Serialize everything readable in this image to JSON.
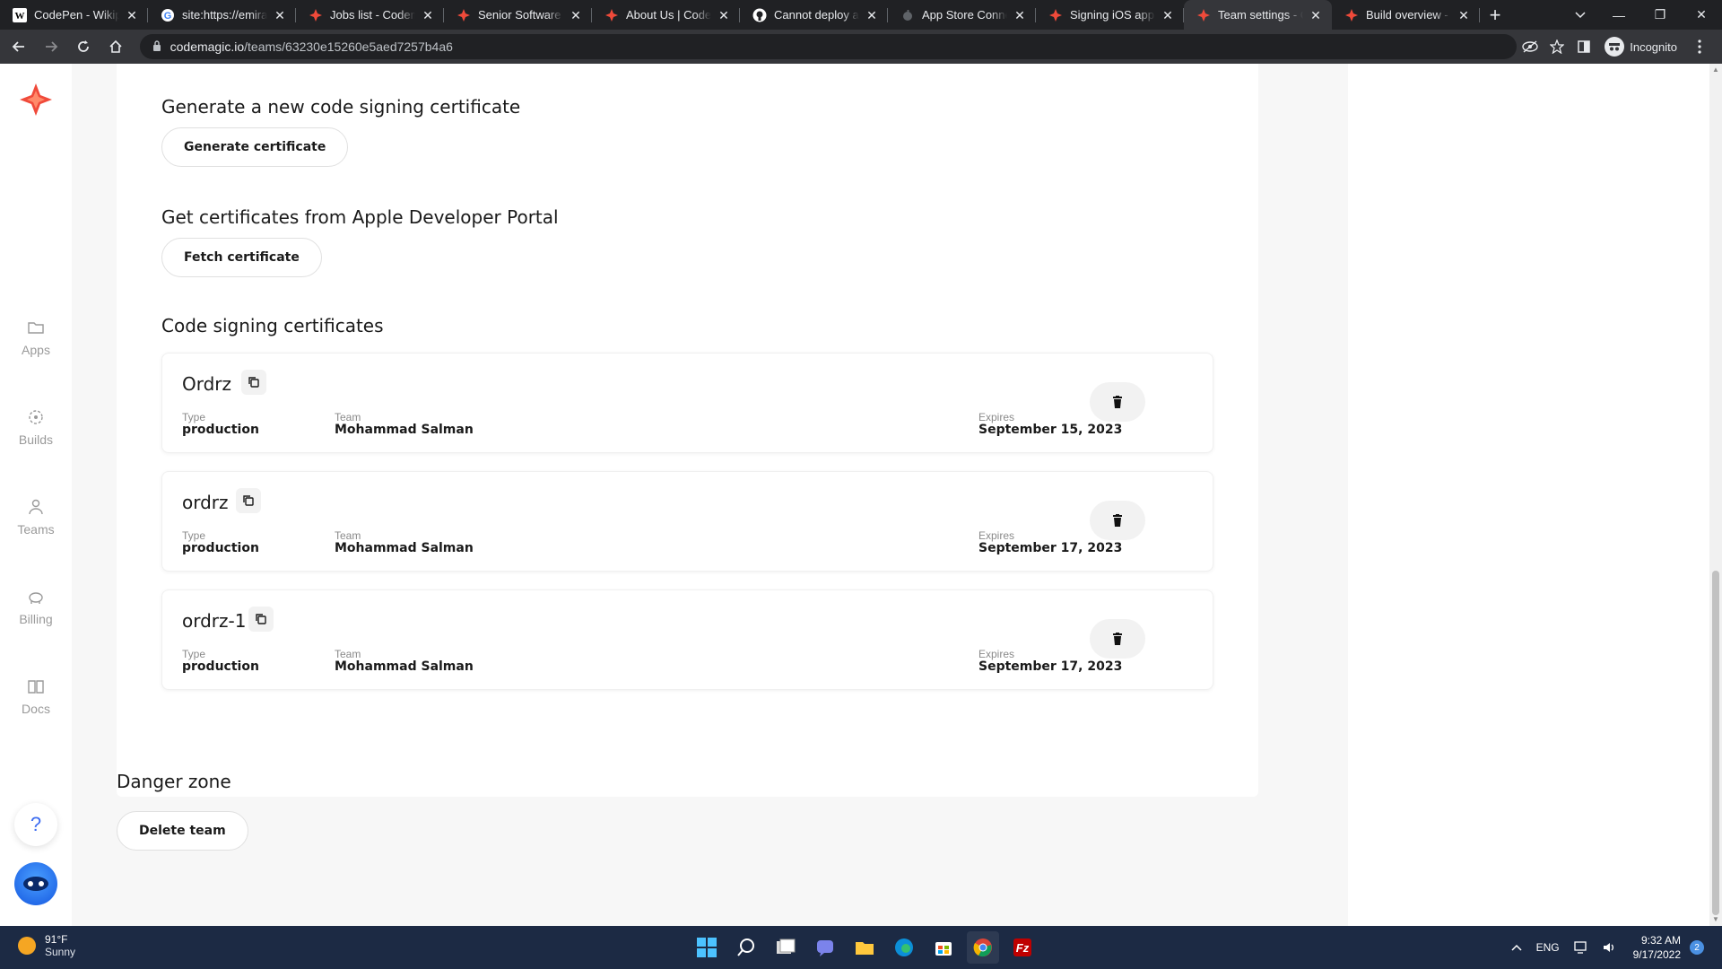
{
  "browser": {
    "tabs": [
      {
        "title": "CodePen - Wikipedia",
        "favicon": "wikipedia-icon"
      },
      {
        "title": "site:https://emirates",
        "favicon": "google-icon"
      },
      {
        "title": "Jobs list - Codemagic",
        "favicon": "codemagic-icon"
      },
      {
        "title": "Senior Software Engineer",
        "favicon": "codemagic-icon"
      },
      {
        "title": "About Us | Codemagic",
        "favicon": "codemagic-icon"
      },
      {
        "title": "Cannot deploy app",
        "favicon": "github-icon"
      },
      {
        "title": "App Store Connect",
        "favicon": "apple-icon"
      },
      {
        "title": "Signing iOS apps - Codemagic",
        "favicon": "codemagic-icon"
      },
      {
        "title": "Team settings - Codemagic",
        "favicon": "codemagic-icon",
        "active": true
      },
      {
        "title": "Build overview - Codemagic",
        "favicon": "codemagic-icon"
      }
    ],
    "url_host": "codemagic.io",
    "url_path": "/teams/63230e15260e5aed7257b4a6",
    "incognito_label": "Incognito"
  },
  "sidebar": {
    "items": [
      {
        "label": "Apps",
        "icon": "folder-icon"
      },
      {
        "label": "Builds",
        "icon": "builds-icon"
      },
      {
        "label": "Teams",
        "icon": "person-icon"
      },
      {
        "label": "Billing",
        "icon": "piggy-bank-icon"
      },
      {
        "label": "Docs",
        "icon": "book-icon"
      }
    ],
    "help_label": "?"
  },
  "generate": {
    "title": "Generate a new code signing certificate",
    "button": "Generate certificate"
  },
  "fetch": {
    "title": "Get certificates from Apple Developer Portal",
    "button": "Fetch certificate"
  },
  "certificates": {
    "title": "Code signing certificates",
    "type_label": "Type",
    "team_label": "Team",
    "expires_label": "Expires",
    "items": [
      {
        "name": "Ordrz",
        "type": "production",
        "team": "Mohammad Salman",
        "expires": "September 15, 2023"
      },
      {
        "name": "ordrz",
        "type": "production",
        "team": "Mohammad Salman",
        "expires": "September 17, 2023"
      },
      {
        "name": "ordrz-1",
        "type": "production",
        "team": "Mohammad Salman",
        "expires": "September 17, 2023"
      }
    ]
  },
  "danger": {
    "title": "Danger zone",
    "button": "Delete team"
  },
  "taskbar": {
    "temperature": "91°F",
    "weather": "Sunny",
    "language": "ENG",
    "time": "9:32 AM",
    "date": "9/17/2022",
    "notifications": "2"
  },
  "colors": {
    "brand": "#f04a3a",
    "taskbar": "#1c2a44",
    "chrome_dark": "#202124"
  }
}
